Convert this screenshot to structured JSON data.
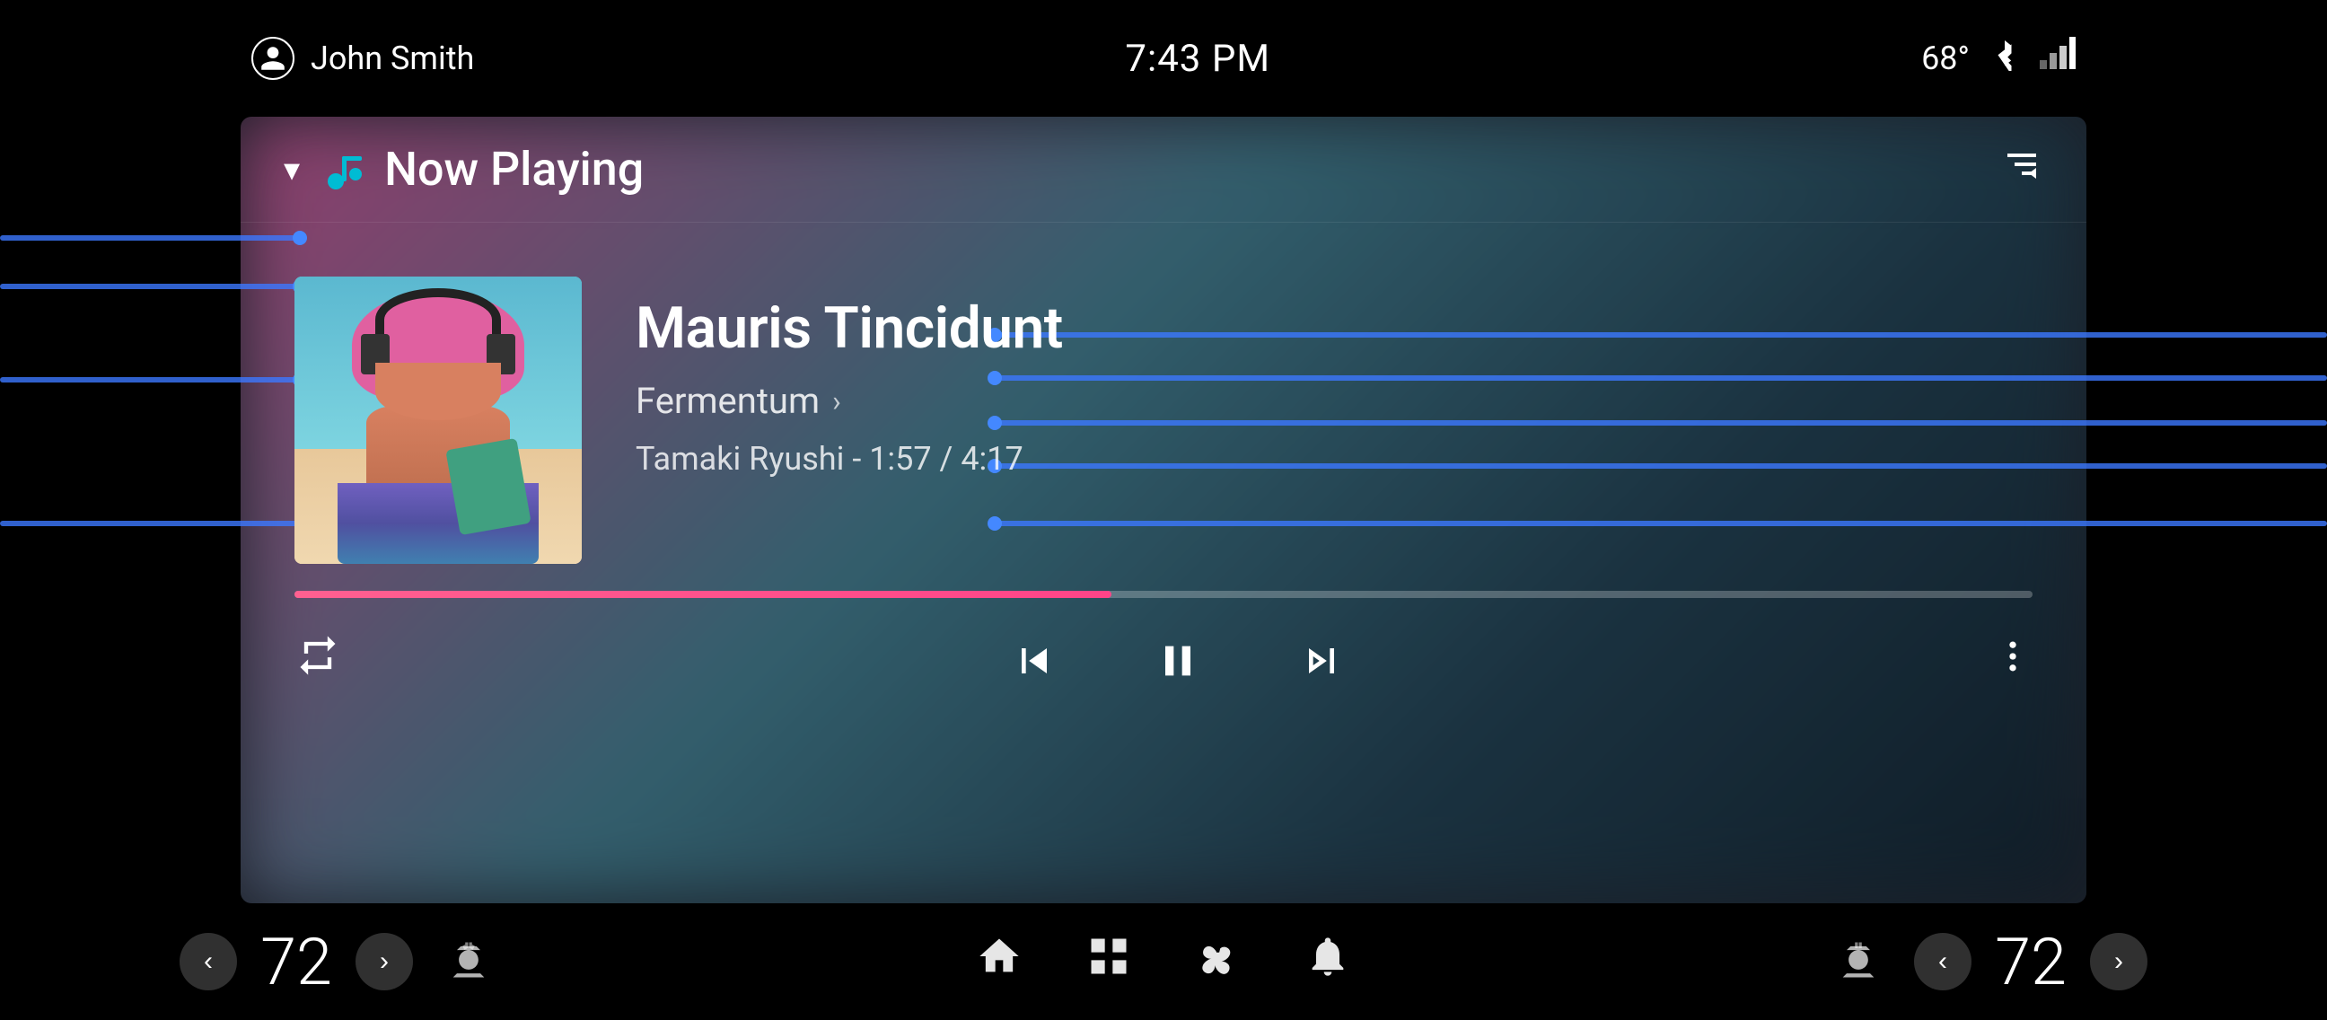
{
  "statusBar": {
    "user": "John Smith",
    "time": "7:43 PM",
    "temperature": "68°",
    "bluetooth": "BT",
    "signal": "signal"
  },
  "player": {
    "headerTitle": "Now Playing",
    "dropdown": "▾",
    "queueIcon": "queue",
    "track": {
      "title": "Mauris Tincidunt",
      "album": "Fermentum",
      "artist": "Tamaki Ryushi",
      "currentTime": "1:57",
      "totalTime": "4:17",
      "artistTime": "Tamaki Ryushi - 1:57 / 4:17",
      "progressPercent": 47
    },
    "controls": {
      "repeat": "⇄",
      "prev": "⏮",
      "pause": "⏸",
      "next": "⏭",
      "more": "⋮"
    }
  },
  "bottomBar": {
    "leftTemp": "72",
    "rightTemp": "72",
    "leftTempArrowLeft": "‹",
    "leftTempArrowRight": "›",
    "rightTempArrowLeft": "‹",
    "rightTempArrowRight": "›",
    "navHome": "home",
    "navGrid": "grid",
    "navFan": "fan",
    "navBell": "bell",
    "leftClimate": "seat-heat-left",
    "rightClimate": "seat-heat-right"
  }
}
